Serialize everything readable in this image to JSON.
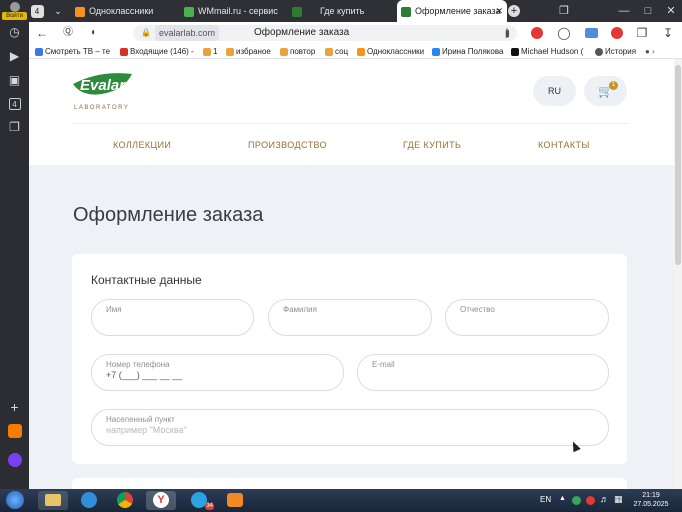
{
  "sidebar": {
    "login_label": "Войти",
    "badge_count": "4"
  },
  "tabs": [
    {
      "label": "Одноклассники",
      "color": "#f7931e"
    },
    {
      "label": "WMmail.ru - сервис по",
      "color": "#4caf50"
    },
    {
      "label": "Где купить",
      "color": "#2e7d32"
    },
    {
      "label": "Оформление заказа",
      "color": "#2e7d32"
    }
  ],
  "tab_counter": "4",
  "address": {
    "domain": "evalarlab.com",
    "page_title": "Оформление заказа"
  },
  "bookmarks": [
    {
      "label": "Смотреть ТВ – те",
      "color": "#3b78e7"
    },
    {
      "label": "Входящие (146) -",
      "color": "#d93025"
    },
    {
      "label": "1",
      "color": "#e8a33d"
    },
    {
      "label": "избраное",
      "color": "#e8a33d"
    },
    {
      "label": "повтор",
      "color": "#e8a33d"
    },
    {
      "label": "соц",
      "color": "#e8a33d"
    },
    {
      "label": "Одноклассники",
      "color": "#f7931e"
    },
    {
      "label": "Ирина Полякова",
      "color": "#2787f5"
    },
    {
      "label": "Michael Hudson (",
      "color": "#111111"
    },
    {
      "label": "История",
      "color": "#555555"
    }
  ],
  "site": {
    "logo_name": "Evalar",
    "logo_sub": "LABORATORY",
    "lang": "RU",
    "cart_count": "1",
    "nav": [
      "КОЛЛЕКЦИИ",
      "ПРОИЗВОДСТВО",
      "ГДЕ КУПИТЬ",
      "КОНТАКТЫ"
    ],
    "page_heading": "Оформление заказа",
    "section_title": "Контактные данные",
    "fields": {
      "first_name": {
        "label": "Имя",
        "value": ""
      },
      "last_name": {
        "label": "Фамилия",
        "value": ""
      },
      "patronymic": {
        "label": "Отчество",
        "value": ""
      },
      "phone": {
        "label": "Номер телефона",
        "value": "+7 (___) ___ __ __"
      },
      "email": {
        "label": "E-mail",
        "value": ""
      },
      "city": {
        "label": "Населенный пункт",
        "placeholder": "например \"Москва\""
      }
    }
  },
  "taskbar": {
    "lang": "EN",
    "time": "21:19",
    "date": "27.05.2025",
    "telegram_badge": "34"
  },
  "colors": {
    "accent": "#9a6f35",
    "brand_green": "#2e8b3e"
  }
}
